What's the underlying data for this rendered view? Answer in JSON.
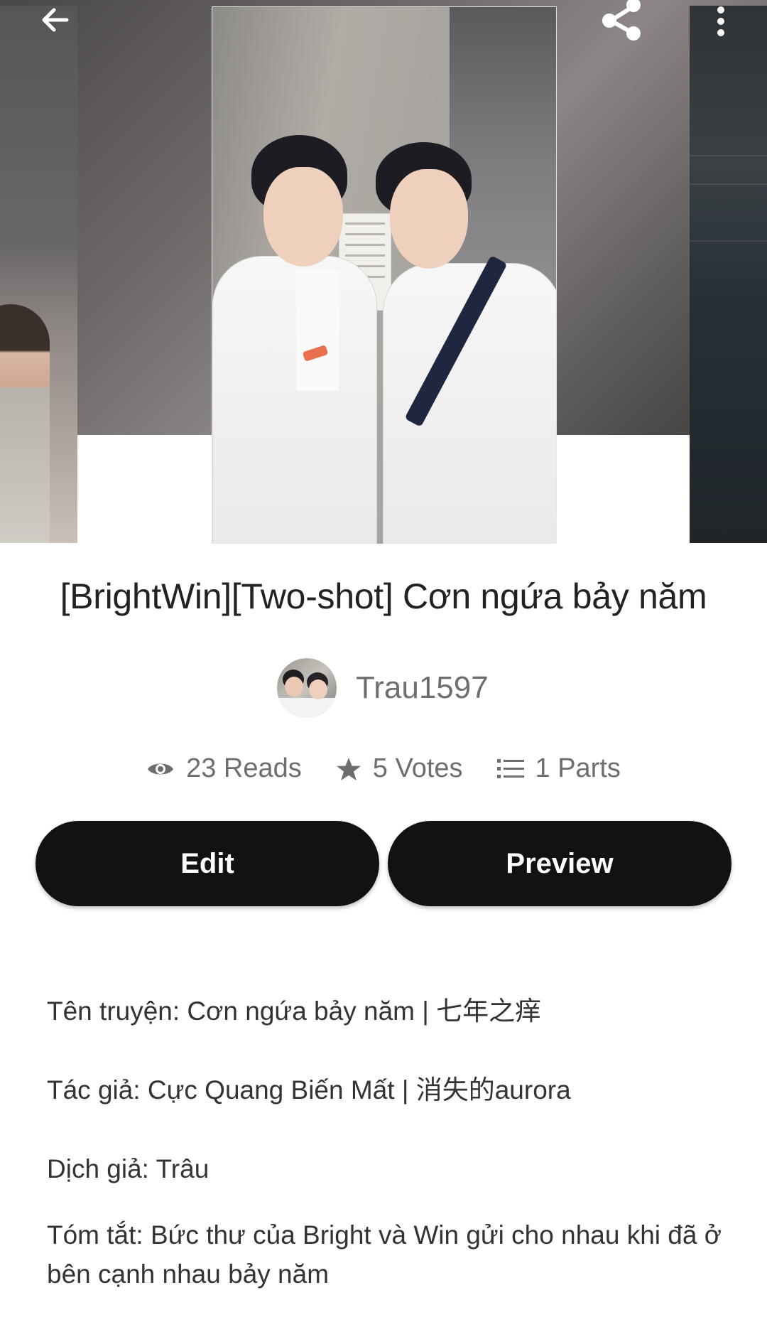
{
  "header": {
    "back_icon": "arrow-left-icon",
    "share_icon": "share-icon",
    "more_icon": "more-vertical-icon"
  },
  "story": {
    "title": "[BrightWin][Two-shot] Cơn ngứa bảy năm",
    "author": "Trau1597",
    "stats": {
      "reads": "23 Reads",
      "votes": "5 Votes",
      "parts": "1 Parts"
    }
  },
  "actions": {
    "edit_label": "Edit",
    "preview_label": "Preview"
  },
  "description": {
    "line1": "Tên truyện: Cơn ngứa bảy năm | 七年之痒",
    "line2": "Tác giả: Cực Quang Biến Mất | 消失的aurora",
    "line3": "Dịch giả: Trâu",
    "line4": "Tóm tắt: Bức thư của Bright và Win gửi cho nhau khi đã ở bên cạnh nhau bảy năm"
  },
  "colors": {
    "button_bg": "#121212",
    "button_text": "#ffffff",
    "meta_text": "#6e6e6e",
    "title_text": "#222222"
  }
}
